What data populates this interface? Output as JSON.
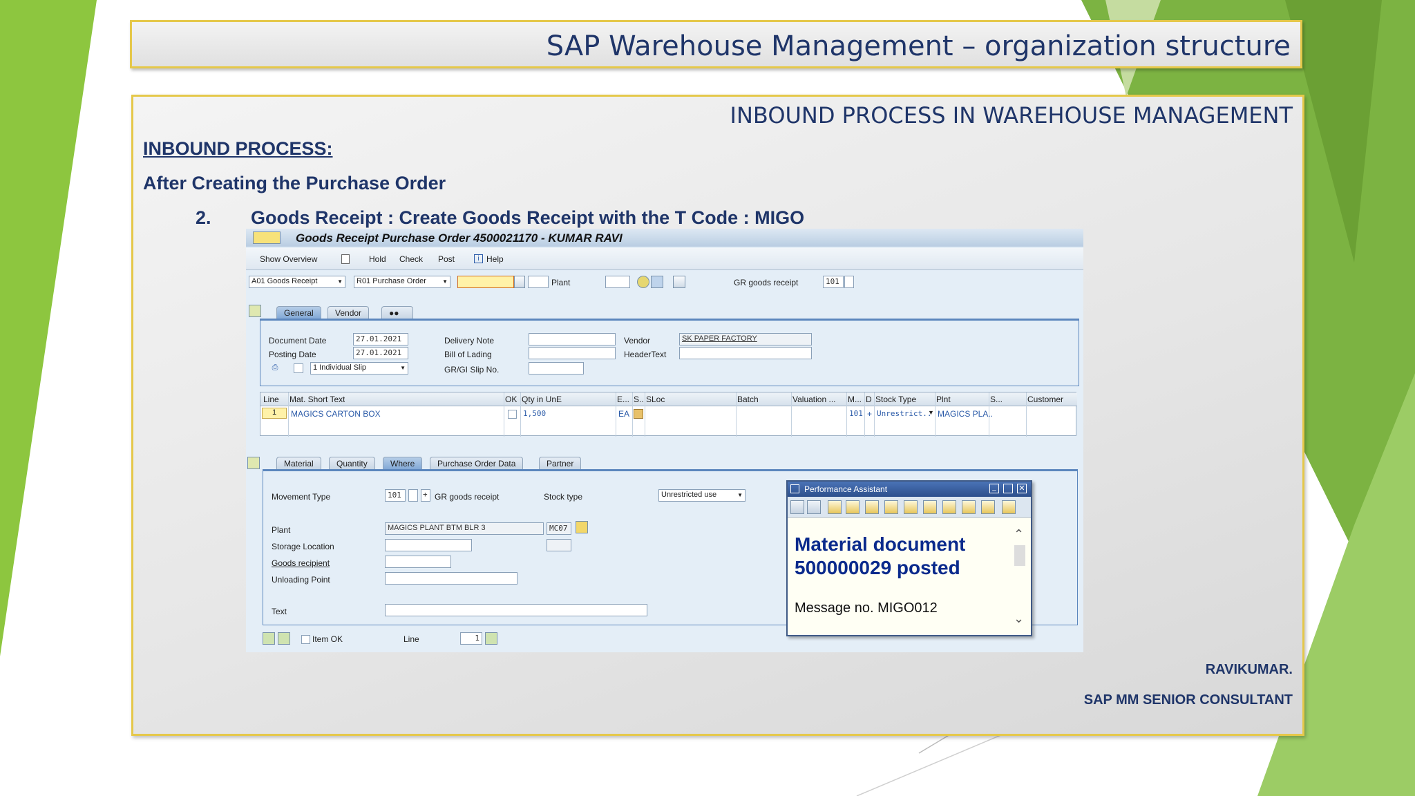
{
  "slide": {
    "title": "SAP Warehouse Management – organization structure",
    "subtitle": "INBOUND PROCESS IN WAREHOUSE MANAGEMENT",
    "heading": "INBOUND PROCESS:",
    "line1": "After Creating the Purchase Order",
    "step_number": "2.",
    "step_text": "Goods Receipt : Create Goods Receipt  with the T Code : MIGO",
    "author": "RAVIKUMAR.",
    "role": "SAP MM  SENIOR CONSULTANT"
  },
  "sap": {
    "window_title": "Goods Receipt Purchase Order 4500021170 - KUMAR RAVI",
    "toolbar": {
      "show_overview": "Show Overview",
      "hold": "Hold",
      "check": "Check",
      "post": "Post",
      "help": "Help"
    },
    "action": "A01 Goods Receipt",
    "reference": "R01 Purchase Order",
    "plant_label": "Plant",
    "gr_label": "GR goods receipt",
    "gr_value": "101",
    "header_tabs": [
      "General",
      "Vendor"
    ],
    "document_date_label": "Document Date",
    "document_date": "27.01.2021",
    "posting_date_label": "Posting Date",
    "posting_date": "27.01.2021",
    "slip": "1 Individual Slip",
    "delivery_note_label": "Delivery Note",
    "bill_of_lading_label": "Bill of Lading",
    "grgi_slip_label": "GR/GI Slip No.",
    "vendor_label": "Vendor",
    "vendor": "SK PAPER FACTORY",
    "header_text_label": "HeaderText",
    "grid_headers": [
      "Line",
      "Mat. Short Text",
      "OK",
      "Qty in UnE",
      "E...",
      "S..",
      "SLoc",
      "Batch",
      "Valuation ...",
      "M...",
      "D",
      "Stock Type",
      "Plnt",
      "S...",
      "Customer"
    ],
    "row": {
      "line": "1",
      "material": "MAGICS CARTON BOX",
      "qty": "1,500",
      "unit": "EA",
      "mvt": "101",
      "d": "+",
      "stock_type": "Unrestrict..",
      "plant": "MAGICS PLA.."
    },
    "detail_tabs": [
      "Material",
      "Quantity",
      "Where",
      "Purchase Order Data",
      "Partner"
    ],
    "movement_type_label": "Movement Type",
    "movement_type": "101",
    "plus": "+",
    "gr_goods_receipt": "GR goods receipt",
    "stock_type_label": "Stock type",
    "stock_type_value": "Unrestricted use",
    "plant_detail_label": "Plant",
    "plant_value": "MAGICS PLANT BTM BLR 3",
    "plant_code": "MC07",
    "storage_location_label": "Storage Location",
    "goods_recipient_label": "Goods recipient",
    "unloading_point_label": "Unloading Point",
    "text_label": "Text",
    "item_ok_label": "Item OK",
    "line_label": "Line",
    "line_value": "1"
  },
  "popup": {
    "title": "Performance Assistant",
    "message_line1": "Material document",
    "message_line2": "500000029 posted",
    "message_no": "Message no. MIGO012"
  },
  "colors": {
    "green": "#8dc63f",
    "accent_border": "#e5c84a",
    "heading": "#1f3569"
  }
}
